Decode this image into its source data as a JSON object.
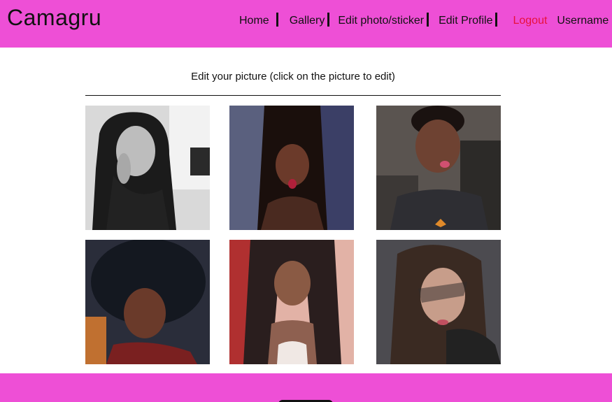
{
  "header": {
    "logo": "Camagru",
    "nav": {
      "home": "Home",
      "gallery": "Gallery",
      "edit": "Edit photo/sticker",
      "profile": "Edit Profile",
      "logout": "Logout",
      "username": "Username"
    }
  },
  "main": {
    "caption": "Edit your picture (click on the picture to edit)"
  },
  "colors": {
    "bar": "#ee4fd6",
    "logout": "#e8103c"
  }
}
